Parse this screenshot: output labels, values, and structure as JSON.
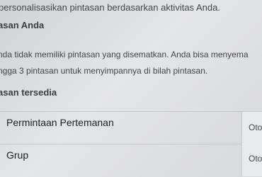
{
  "intro_text": "personalisasikan pintasan berdasarkan aktivitas Anda.",
  "pinned_section": {
    "title": "asan Anda",
    "desc_line1": "nda tidak memiliki pintasan yang disematkan. Anda bisa menyema",
    "desc_line2": "ngga 3 pintasan untuk menyimpannya di bilah pintasan."
  },
  "available_section": {
    "title": "asan tersedia",
    "items": [
      {
        "label": "Permintaan Pertemanan",
        "value": "Oto"
      },
      {
        "label": "Grup",
        "value": "Oto"
      }
    ]
  }
}
